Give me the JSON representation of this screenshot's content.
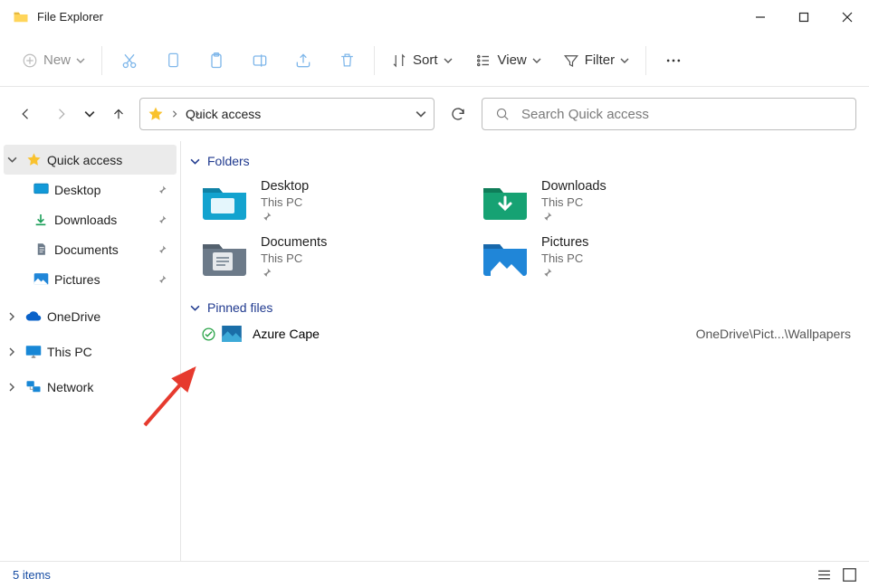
{
  "title": "File Explorer",
  "toolbar": {
    "new_label": "New",
    "sort_label": "Sort",
    "view_label": "View",
    "filter_label": "Filter"
  },
  "address": {
    "location": "Quick access"
  },
  "search": {
    "placeholder": "Search Quick access"
  },
  "sidebar": {
    "quick_access": "Quick access",
    "qa_items": [
      {
        "label": "Desktop"
      },
      {
        "label": "Downloads"
      },
      {
        "label": "Documents"
      },
      {
        "label": "Pictures"
      }
    ],
    "onedrive": "OneDrive",
    "thispc": "This PC",
    "network": "Network"
  },
  "sections": {
    "folders": "Folders",
    "pinned": "Pinned files"
  },
  "folders": [
    {
      "name": "Desktop",
      "loc": "This PC"
    },
    {
      "name": "Downloads",
      "loc": "This PC"
    },
    {
      "name": "Documents",
      "loc": "This PC"
    },
    {
      "name": "Pictures",
      "loc": "This PC"
    }
  ],
  "pinned_files": [
    {
      "name": "Azure Cape",
      "path": "OneDrive\\Pict...\\Wallpapers"
    }
  ],
  "status": {
    "item_count": "5 items"
  }
}
